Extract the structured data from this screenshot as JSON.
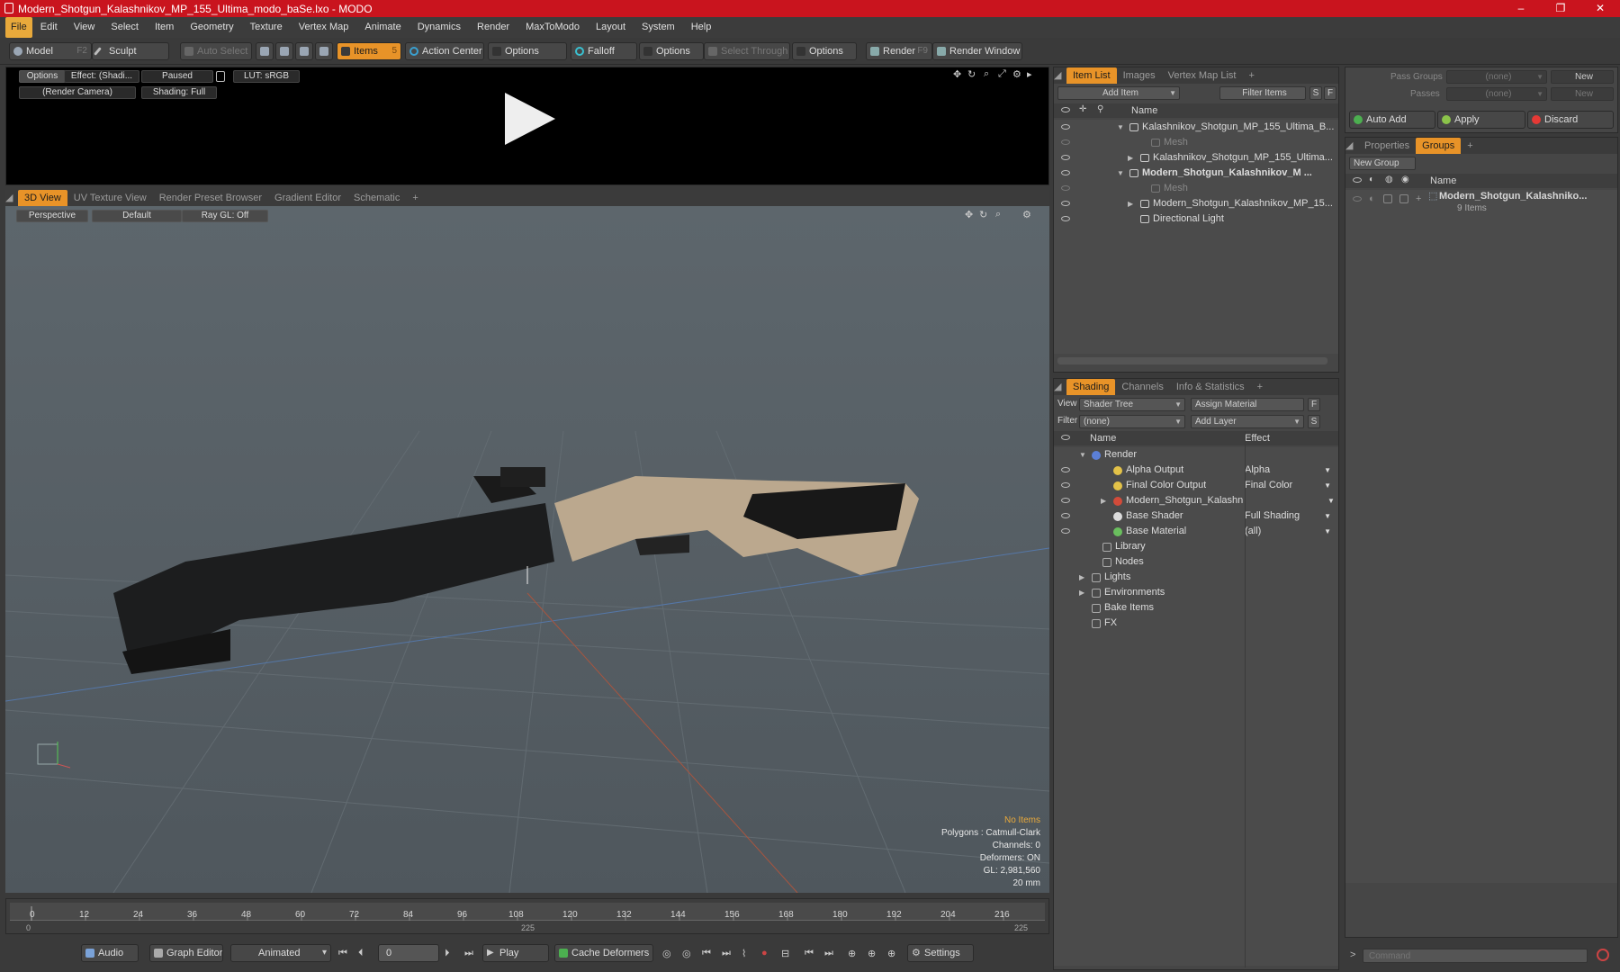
{
  "window": {
    "title": "Modern_Shotgun_Kalashnikov_MP_155_Ultima_modo_baSe.lxo - MODO",
    "min": "–",
    "max": "❐",
    "close": "✕"
  },
  "menu": [
    "File",
    "Edit",
    "View",
    "Select",
    "Item",
    "Geometry",
    "Texture",
    "Vertex Map",
    "Animate",
    "Dynamics",
    "Render",
    "MaxToModo",
    "Layout",
    "System",
    "Help"
  ],
  "toolbar": {
    "model": "Model",
    "model_key": "F2",
    "sculpt": "Sculpt",
    "auto_select": "Auto Select",
    "items": "Items",
    "items_key": "5",
    "action_center": "Action Center",
    "options1": "Options",
    "falloff": "Falloff",
    "options2": "Options",
    "select_through": "Select Through",
    "options3": "Options",
    "render": "Render",
    "render_key": "F9",
    "render_window": "Render Window"
  },
  "preview": {
    "options": "Options",
    "effect": "Effect: (Shadi...",
    "paused": "Paused",
    "lut": "LUT: sRGB",
    "camera": "(Render Camera)",
    "shading": "Shading: Full"
  },
  "viewport": {
    "tabs": [
      "3D View",
      "UV Texture View",
      "Render Preset Browser",
      "Gradient Editor",
      "Schematic",
      "+"
    ],
    "perspective": "Perspective",
    "default": "Default",
    "raygl": "Ray GL: Off",
    "stats": {
      "no_items": "No Items",
      "polygons": "Polygons : Catmull-Clark",
      "channels": "Channels: 0",
      "deformers": "Deformers: ON",
      "gl": "GL: 2,981,560",
      "size": "20 mm"
    }
  },
  "timeline": {
    "ticks": [
      "0",
      "12",
      "24",
      "36",
      "48",
      "60",
      "72",
      "84",
      "96",
      "108",
      "120",
      "132",
      "144",
      "156",
      "168",
      "180",
      "192",
      "204",
      "216"
    ],
    "sub_start": "0",
    "sub_mid": "225",
    "sub_end": "225"
  },
  "bottom": {
    "audio": "Audio",
    "graph_editor": "Graph Editor",
    "animated": "Animated",
    "frame": "0",
    "play": "Play",
    "cache": "Cache Deformers",
    "settings": "Settings"
  },
  "itemlist": {
    "tabs": [
      "Item List",
      "Images",
      "Vertex Map List",
      "+"
    ],
    "add_item": "Add Item",
    "filter": "Filter Items",
    "s": "S",
    "f": "F",
    "col_name": "Name",
    "rows": [
      {
        "label": "Kalashnikov_Shotgun_MP_155_Ultima_B...",
        "indent": 0,
        "expander": "▼",
        "bold": false,
        "dim": false
      },
      {
        "label": "Mesh",
        "indent": 2,
        "expander": "",
        "bold": false,
        "dim": true
      },
      {
        "label": "Kalashnikov_Shotgun_MP_155_Ultima...",
        "indent": 1,
        "expander": "▶",
        "bold": false,
        "dim": false
      },
      {
        "label": "Modern_Shotgun_Kalashnikov_M ...",
        "indent": 0,
        "expander": "▼",
        "bold": true,
        "dim": false
      },
      {
        "label": "Mesh",
        "indent": 2,
        "expander": "",
        "bold": false,
        "dim": true
      },
      {
        "label": "Modern_Shotgun_Kalashnikov_MP_15...",
        "indent": 1,
        "expander": "▶",
        "bold": false,
        "dim": false
      },
      {
        "label": "Directional Light",
        "indent": 1,
        "expander": "",
        "bold": false,
        "dim": false
      }
    ]
  },
  "shading": {
    "tabs": [
      "Shading",
      "Channels",
      "Info & Statistics",
      "+"
    ],
    "view_label": "View",
    "view_value": "Shader Tree",
    "assign": "Assign Material",
    "f": "F",
    "filter_label": "Filter",
    "filter_value": "(none)",
    "add_layer": "Add Layer",
    "s": "S",
    "col_name": "Name",
    "col_effect": "Effect",
    "rows": [
      {
        "label": "Render",
        "effect": "",
        "indent": 0,
        "expander": "▼",
        "eye": false
      },
      {
        "label": "Alpha Output",
        "effect": "Alpha",
        "indent": 2,
        "expander": "",
        "eye": true
      },
      {
        "label": "Final Color Output",
        "effect": "Final Color",
        "indent": 2,
        "expander": "",
        "eye": true
      },
      {
        "label": "Modern_Shotgun_Kalashni ...",
        "effect": "",
        "indent": 2,
        "expander": "▶",
        "eye": true
      },
      {
        "label": "Base Shader",
        "effect": "Full Shading",
        "indent": 2,
        "expander": "",
        "eye": true
      },
      {
        "label": "Base Material",
        "effect": "(all)",
        "indent": 2,
        "expander": "",
        "eye": true
      },
      {
        "label": "Library",
        "effect": "",
        "indent": 1,
        "expander": "",
        "eye": false
      },
      {
        "label": "Nodes",
        "effect": "",
        "indent": 1,
        "expander": "",
        "eye": false
      },
      {
        "label": "Lights",
        "effect": "",
        "indent": 0,
        "expander": "▶",
        "eye": false
      },
      {
        "label": "Environments",
        "effect": "",
        "indent": 0,
        "expander": "▶",
        "eye": false
      },
      {
        "label": "Bake Items",
        "effect": "",
        "indent": 0,
        "expander": "",
        "eye": false
      },
      {
        "label": "FX",
        "effect": "",
        "indent": 0,
        "expander": "",
        "eye": false
      }
    ]
  },
  "passes": {
    "pass_groups": "Pass Groups",
    "passes": "Passes",
    "none1": "(none)",
    "none2": "(none)",
    "new1": "New",
    "new2": "New",
    "auto_add": "Auto Add",
    "apply": "Apply",
    "discard": "Discard"
  },
  "groups": {
    "tabs": [
      "Properties",
      "Groups",
      "+"
    ],
    "new_group": "New Group",
    "col_name": "Name",
    "group_name": "Modern_Shotgun_Kalashniko...",
    "group_count": "9 Items"
  },
  "command": {
    "placeholder": "Command"
  },
  "colors": {
    "accent": "#e89328",
    "title": "#c9141e"
  }
}
